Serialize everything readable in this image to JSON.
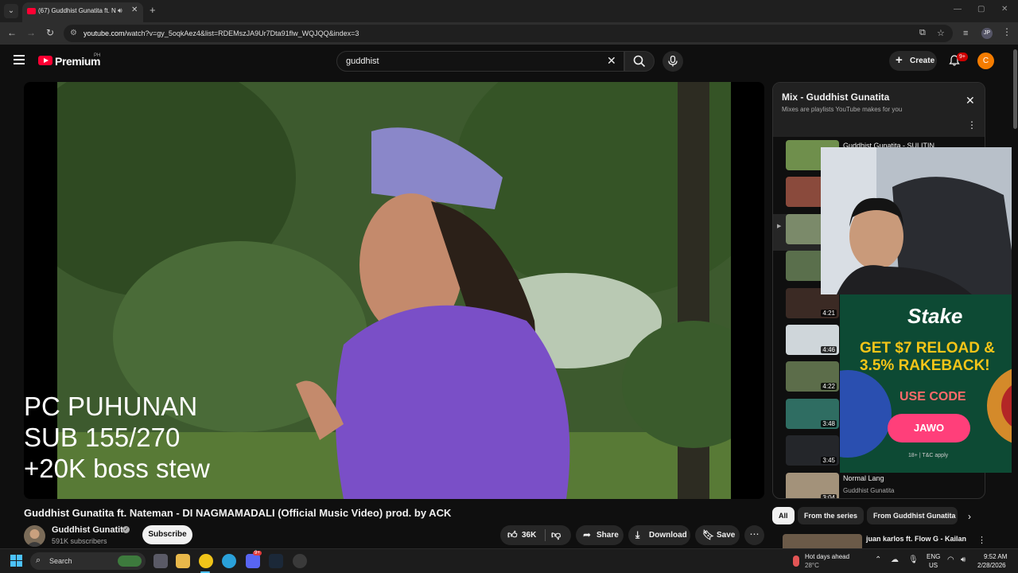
{
  "browser": {
    "tab_title": "(67) Guddhist Gunatita ft. N",
    "url_host": "youtube.com",
    "url_path": "/watch?v=gy_5oqkAez4&list=RDEMszJA9Ur7Dta91flw_WQJQQ&index=3"
  },
  "masthead": {
    "logo_text": "Premium",
    "region": "PH",
    "search_value": "guddhist",
    "create_label": "Create",
    "notification_count": "9+",
    "avatar_letter": "C"
  },
  "overlay_text": "PC PUHUNAN\nSUB 155/270\n+20K boss stew",
  "playlist": {
    "title": "Mix - Guddhist Gunatita",
    "subtitle": "Mixes are playlists YouTube makes for you",
    "items": [
      {
        "title": "Guddhist Gunatita - SULITIN",
        "channel": "",
        "duration": "",
        "color": "#6f8f4c"
      },
      {
        "title": "",
        "channel": "",
        "duration": "",
        "color": "#8a4a3c"
      },
      {
        "title": "",
        "channel": "",
        "duration": "",
        "color": "#7b8a6a"
      },
      {
        "title": "",
        "channel": "",
        "duration": "",
        "color": "#5a6f4c"
      },
      {
        "title": "",
        "channel": "",
        "duration": "4:21",
        "color": "#3b2a24"
      },
      {
        "title": "",
        "channel": "",
        "duration": "4:46",
        "color": "#cfd6da"
      },
      {
        "title": "",
        "channel": "",
        "duration": "4:22",
        "color": "#5c6d4a"
      },
      {
        "title": "",
        "channel": "",
        "duration": "3:48",
        "color": "#2f6d62"
      },
      {
        "title": "",
        "channel": "",
        "duration": "3:45",
        "color": "#24262a"
      },
      {
        "title": "Normal Lang",
        "channel": "Guddhist Gunatita",
        "duration": "3:04",
        "color": "#a3927a"
      }
    ]
  },
  "ad": {
    "brand": "Stake",
    "line1": "GET $7 RELOAD &",
    "line2": "3.5% RAKEBACK!",
    "use_code": "USE CODE",
    "code": "JAWO",
    "fine_print": "18+ | T&C apply"
  },
  "video": {
    "title": "Guddhist Gunatita ft. Nateman - DI NAGMAMADALI (Official Music Video) prod. by ACK",
    "channel": "Guddhist Gunatita",
    "subscribers": "591K subscribers",
    "subscribe_label": "Subscribe",
    "likes": "36K",
    "share_label": "Share",
    "download_label": "Download",
    "save_label": "Save"
  },
  "chips": [
    "All",
    "From the series",
    "From Guddhist Gunatita"
  ],
  "recommendation": {
    "title": "juan karlos ft. Flow G - Kailan"
  },
  "taskbar": {
    "search_label": "Search",
    "weather_title": "Hot days ahead",
    "weather_temp": "28°C",
    "lang1": "ENG",
    "lang2": "US",
    "time": "9:52 AM",
    "date": "2/28/2026",
    "discord_badge": "9+"
  },
  "colors": {
    "brand_red": "#ff0033",
    "background": "#0f0f0f",
    "ad_yellow": "#f5c518",
    "ad_button": "#ff3f7a"
  }
}
